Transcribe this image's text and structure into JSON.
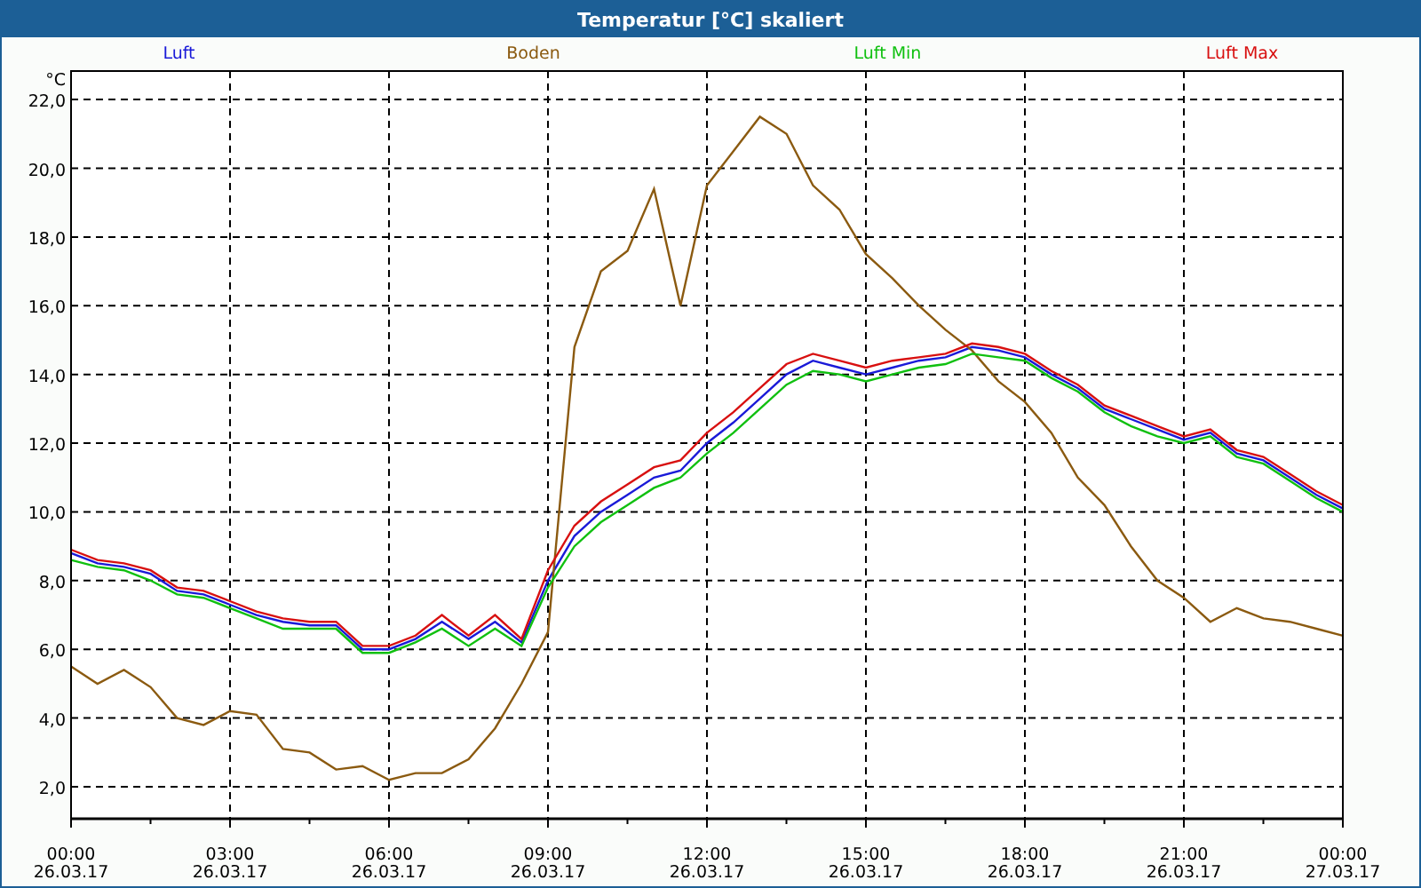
{
  "chart_data": {
    "type": "line",
    "title": "Temperatur [°C] skaliert",
    "ylabel": "°C",
    "categories": [
      "00:00\n26.03.17",
      null,
      null,
      null,
      null,
      null,
      "03:00\n26.03.17",
      null,
      null,
      null,
      null,
      null,
      "06:00\n26.03.17",
      null,
      null,
      null,
      null,
      null,
      "09:00\n26.03.17",
      null,
      null,
      null,
      null,
      null,
      "12:00\n26.03.17",
      null,
      null,
      null,
      null,
      null,
      "15:00\n26.03.17",
      null,
      null,
      null,
      null,
      null,
      "18:00\n26.03.17",
      null,
      null,
      null,
      null,
      null,
      "21:00\n26.03.17",
      null,
      null,
      null,
      null,
      null,
      "00:00\n27.03.17"
    ],
    "series": [
      {
        "name": "Luft",
        "color": "#1a1ad8",
        "values": [
          8.8,
          8.5,
          8.4,
          8.2,
          7.7,
          7.6,
          7.3,
          7.0,
          6.8,
          6.7,
          6.7,
          6.0,
          6.0,
          6.3,
          6.8,
          6.3,
          6.8,
          6.2,
          8.0,
          9.3,
          10.0,
          10.5,
          11.0,
          11.2,
          12.0,
          12.6,
          13.3,
          14.0,
          14.4,
          14.2,
          14.0,
          14.2,
          14.4,
          14.5,
          14.8,
          14.7,
          14.5,
          14.0,
          13.6,
          13.0,
          12.7,
          12.4,
          12.1,
          12.3,
          11.7,
          11.5,
          11.0,
          10.5,
          10.1
        ]
      },
      {
        "name": "Boden",
        "color": "#8b5a10",
        "values": [
          5.5,
          5.0,
          5.4,
          4.9,
          4.0,
          3.8,
          4.2,
          4.1,
          3.1,
          3.0,
          2.5,
          2.6,
          2.2,
          2.4,
          2.4,
          2.8,
          3.7,
          5.0,
          6.5,
          14.8,
          17.0,
          17.6,
          19.4,
          16.0,
          19.5,
          20.5,
          21.5,
          21.0,
          19.5,
          18.8,
          17.5,
          16.8,
          16.0,
          15.3,
          14.7,
          13.8,
          13.2,
          12.3,
          11.0,
          10.2,
          9.0,
          8.0,
          7.5,
          6.8,
          7.2,
          6.9,
          6.8,
          6.6,
          6.4
        ]
      },
      {
        "name": "Luft Min",
        "color": "#10c010",
        "values": [
          8.6,
          8.4,
          8.3,
          8.0,
          7.6,
          7.5,
          7.2,
          6.9,
          6.6,
          6.6,
          6.6,
          5.9,
          5.9,
          6.2,
          6.6,
          6.1,
          6.6,
          6.1,
          7.8,
          9.0,
          9.7,
          10.2,
          10.7,
          11.0,
          11.7,
          12.3,
          13.0,
          13.7,
          14.1,
          14.0,
          13.8,
          14.0,
          14.2,
          14.3,
          14.6,
          14.5,
          14.4,
          13.9,
          13.5,
          12.9,
          12.5,
          12.2,
          12.0,
          12.2,
          11.6,
          11.4,
          10.9,
          10.4,
          10.0
        ]
      },
      {
        "name": "Luft Max",
        "color": "#d81010",
        "values": [
          8.9,
          8.6,
          8.5,
          8.3,
          7.8,
          7.7,
          7.4,
          7.1,
          6.9,
          6.8,
          6.8,
          6.1,
          6.1,
          6.4,
          7.0,
          6.4,
          7.0,
          6.3,
          8.3,
          9.6,
          10.3,
          10.8,
          11.3,
          11.5,
          12.3,
          12.9,
          13.6,
          14.3,
          14.6,
          14.4,
          14.2,
          14.4,
          14.5,
          14.6,
          14.9,
          14.8,
          14.6,
          14.1,
          13.7,
          13.1,
          12.8,
          12.5,
          12.2,
          12.4,
          11.8,
          11.6,
          11.1,
          10.6,
          10.2
        ]
      }
    ],
    "ylim": [
      1.07,
      22.83
    ],
    "grid": true,
    "yticks": [
      {
        "value": 2,
        "label": "2,0"
      },
      {
        "value": 4,
        "label": "4,0"
      },
      {
        "value": 6,
        "label": "6,0"
      },
      {
        "value": 8,
        "label": "8,0"
      },
      {
        "value": 10,
        "label": "10,0"
      },
      {
        "value": 12,
        "label": "12,0"
      },
      {
        "value": 14,
        "label": "14,0"
      },
      {
        "value": 16,
        "label": "16,0"
      },
      {
        "value": 18,
        "label": "18,0"
      },
      {
        "value": 20,
        "label": "20,0"
      },
      {
        "value": 22,
        "label": "22,0"
      }
    ]
  }
}
